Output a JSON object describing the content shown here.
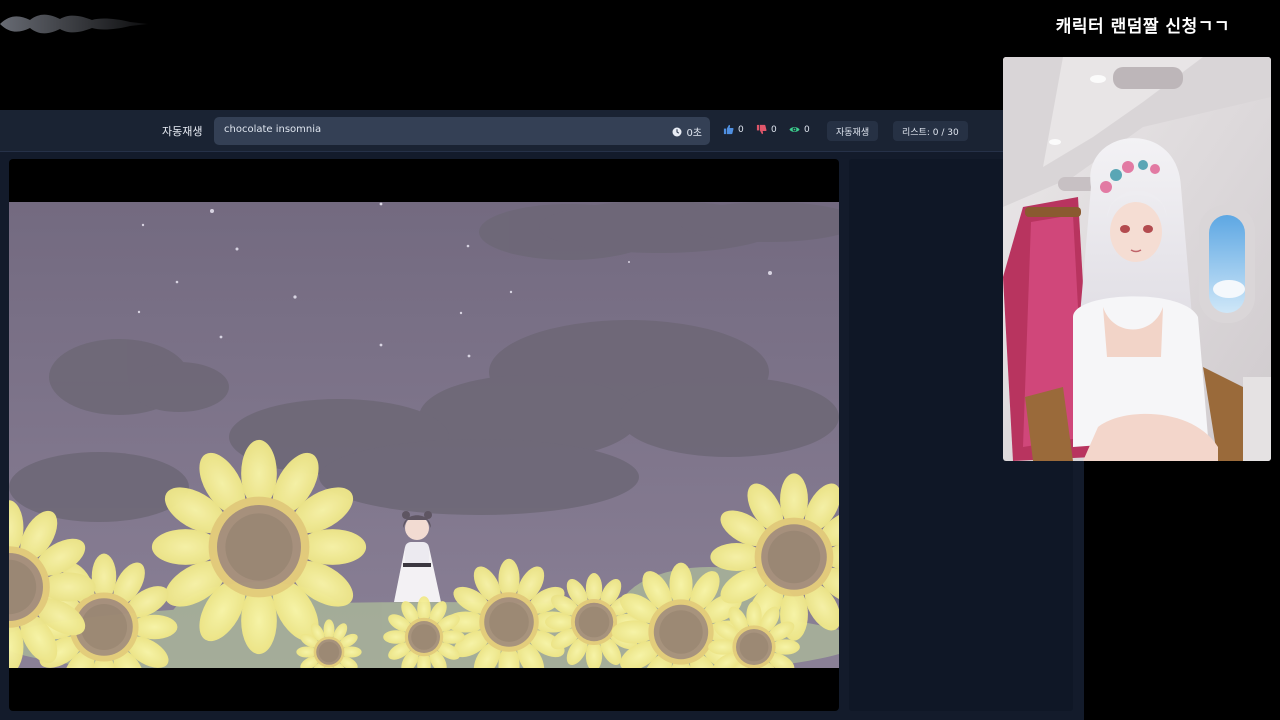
{
  "overlay": {
    "title": "캐릭터 랜덤짤 신청ㄱㄱ"
  },
  "toolbar": {
    "autoplay_label": "자동재생",
    "search_value": "chocolate insomnia",
    "duration": "0초",
    "likes": "0",
    "dislikes": "0",
    "views": "0",
    "autoplay_button": "자동재생",
    "playlist_counter": "리스트: 0 / 30"
  },
  "icons": {
    "duration": "clock-icon",
    "likes": "thumbs-up-icon",
    "dislikes": "thumbs-down-icon",
    "views": "eye-icon"
  },
  "colors": {
    "app_background": "#131b2b",
    "toolbar_background": "#1a2333",
    "search_background": "#344055",
    "pill_background": "#263144",
    "like_icon": "#4f8fe0",
    "dislike_icon": "#e0566a",
    "view_icon": "#3ccf8e"
  }
}
